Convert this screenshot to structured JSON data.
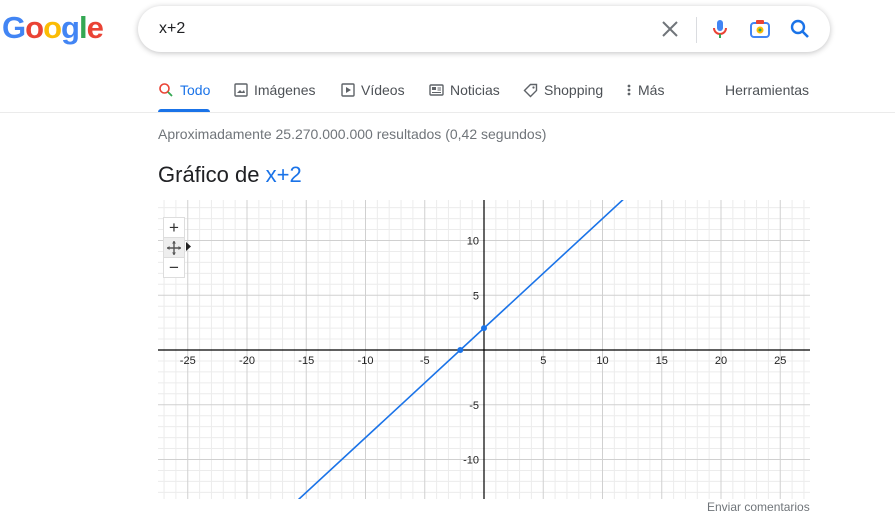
{
  "logo": {
    "text": "Google"
  },
  "search": {
    "query": "x+2"
  },
  "icons": {
    "clear": "close-icon",
    "mic": "microphone-icon",
    "lens": "camera-lens-icon",
    "search": "search-icon"
  },
  "tabs": [
    {
      "label": "Todo",
      "icon": "search-icon",
      "active": true
    },
    {
      "label": "Imágenes",
      "icon": "image-icon"
    },
    {
      "label": "Vídeos",
      "icon": "play-icon"
    },
    {
      "label": "Noticias",
      "icon": "news-icon"
    },
    {
      "label": "Shopping",
      "icon": "tag-icon"
    },
    {
      "label": "Más",
      "icon": "more-vert-icon"
    }
  ],
  "tools_label": "Herramientas",
  "results_stats": "Aproximadamente 25.270.000.000 resultados (0,42 segundos)",
  "graph": {
    "title_prefix": "Gráfico de",
    "function_label": "x+2",
    "feedback": "Enviar comentarios",
    "zoom_in": "+",
    "zoom_out": "−"
  },
  "chart_data": {
    "type": "line",
    "function": "x+2",
    "xlim": [
      -27.5,
      27.5
    ],
    "ylim": [
      -13.5,
      13.5
    ],
    "x_ticks": [
      -25,
      -20,
      -15,
      -10,
      -5,
      5,
      10,
      15,
      20,
      25
    ],
    "y_ticks": [
      10,
      5,
      -5,
      -10
    ],
    "points": [
      {
        "x": -2,
        "y": 0
      },
      {
        "x": 0,
        "y": 2
      }
    ],
    "colors": {
      "line": "#1a73e8",
      "grid_major": "#d0d0d0",
      "grid_minor": "#ececec",
      "axis": "#000000"
    }
  }
}
